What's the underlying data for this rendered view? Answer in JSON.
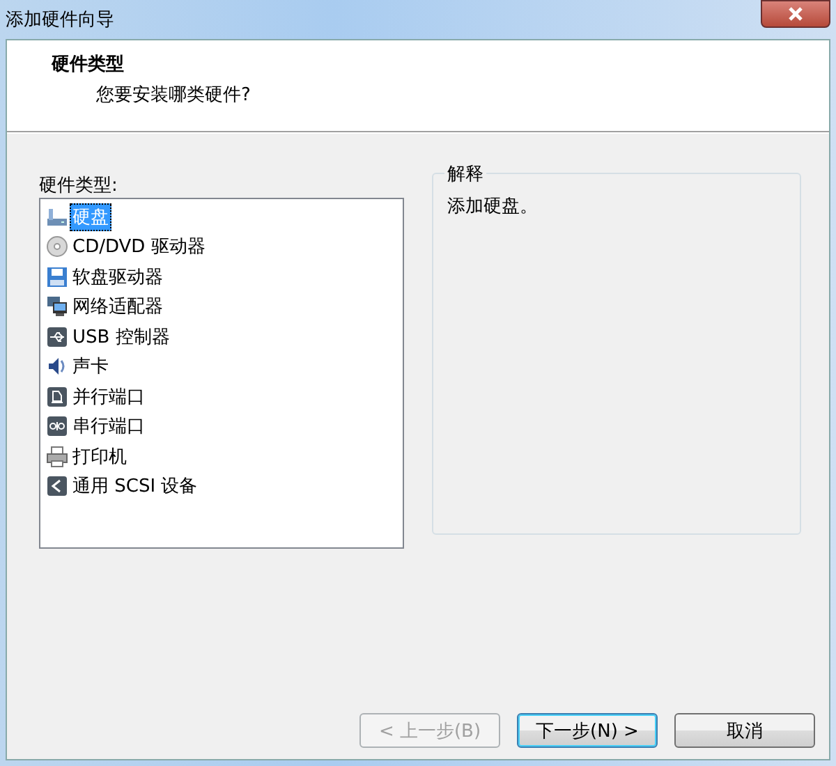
{
  "window": {
    "title": "添加硬件向导"
  },
  "header": {
    "title": "硬件类型",
    "subtitle": "您要安装哪类硬件?"
  },
  "list": {
    "label": "硬件类型:",
    "items": [
      {
        "label": "硬盘",
        "kind": "disk",
        "selected": true
      },
      {
        "label": "CD/DVD 驱动器",
        "kind": "cd",
        "selected": false
      },
      {
        "label": "软盘驱动器",
        "kind": "floppy",
        "selected": false
      },
      {
        "label": "网络适配器",
        "kind": "network",
        "selected": false
      },
      {
        "label": "USB 控制器",
        "kind": "usb",
        "selected": false
      },
      {
        "label": "声卡",
        "kind": "sound",
        "selected": false
      },
      {
        "label": "并行端口",
        "kind": "parallel",
        "selected": false
      },
      {
        "label": "串行端口",
        "kind": "serial",
        "selected": false
      },
      {
        "label": "打印机",
        "kind": "printer",
        "selected": false
      },
      {
        "label": "通用 SCSI 设备",
        "kind": "scsi",
        "selected": false
      }
    ]
  },
  "explanation": {
    "title": "解释",
    "text": "添加硬盘。"
  },
  "buttons": [
    {
      "label": "< 上一步(B)",
      "disabled": true,
      "default": false
    },
    {
      "label": "下一步(N) >",
      "disabled": false,
      "default": true
    },
    {
      "label": "取消",
      "disabled": false,
      "default": false
    }
  ]
}
